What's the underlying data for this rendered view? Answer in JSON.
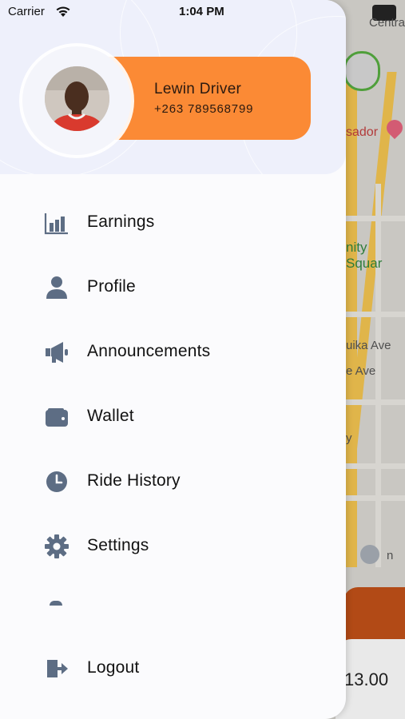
{
  "status_bar": {
    "carrier": "Carrier",
    "time": "1:04 PM"
  },
  "map": {
    "labels": [
      "Centra",
      "sador",
      "nity Squar",
      "uika Ave",
      "e Ave",
      "y",
      "n"
    ],
    "fare": "13.00"
  },
  "user": {
    "name": "Lewin Driver",
    "phone": "+263 789568799"
  },
  "menu": [
    {
      "label": "Earnings",
      "icon": "bar-chart-icon"
    },
    {
      "label": "Profile",
      "icon": "person-icon"
    },
    {
      "label": "Announcements",
      "icon": "megaphone-icon"
    },
    {
      "label": "Wallet",
      "icon": "wallet-icon"
    },
    {
      "label": "Ride History",
      "icon": "clock-icon"
    },
    {
      "label": "Settings",
      "icon": "gear-icon"
    }
  ],
  "logout": {
    "label": "Logout",
    "icon": "logout-icon"
  },
  "colors": {
    "accent": "#fb8a35",
    "icon": "#5d6d84",
    "drawer_bg": "#fbfbfd",
    "header_bg": "#eef0fb"
  }
}
